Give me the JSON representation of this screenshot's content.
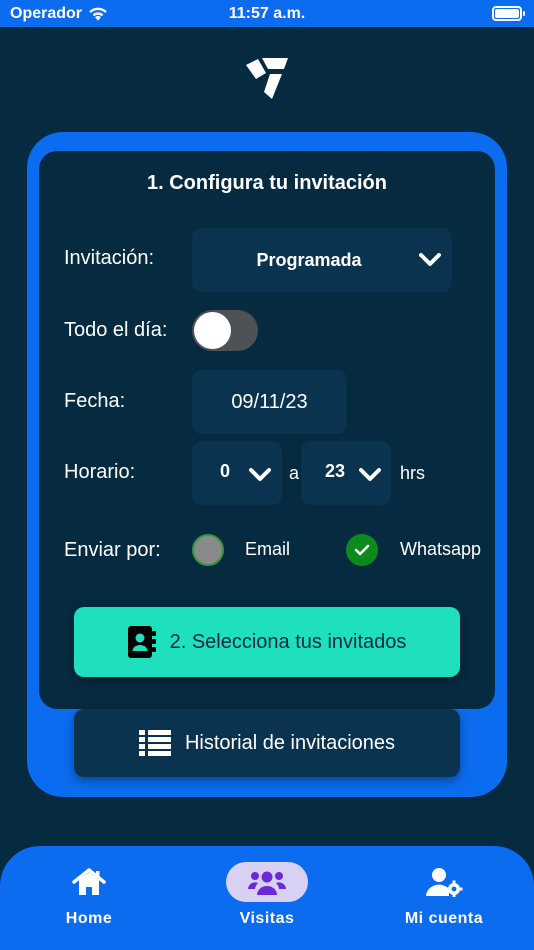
{
  "status_bar": {
    "carrier": "Operador",
    "time": "11:57 a.m."
  },
  "card": {
    "title": "1. Configura tu invitación"
  },
  "form": {
    "invitation_label": "Invitación:",
    "invitation_value": "Programada",
    "allday_label": "Todo el día:",
    "allday_on": false,
    "date_label": "Fecha:",
    "date_value": "09/11/23",
    "time_label": "Horario:",
    "time_from": "0",
    "time_sep": "a",
    "time_to": "23",
    "time_unit": "hrs",
    "send_label": "Enviar por:",
    "option_email": "Email",
    "option_whatsapp": "Whatsapp",
    "email_selected": false,
    "whatsapp_selected": true
  },
  "buttons": {
    "select_guests": "2. Selecciona tus invitados",
    "history": "Historial de invitaciones"
  },
  "nav": {
    "home": "Home",
    "visits": "Visitas",
    "account": "Mi cuenta",
    "active": "visits"
  },
  "colors": {
    "background": "#062b41",
    "accent_blue": "#0c6cf0",
    "teal_button": "#1fe0bc",
    "active_pill": "#d9d1f4",
    "check_green": "#0d8a1c"
  },
  "icons": {
    "wifi": "wifi-icon",
    "battery": "battery-icon",
    "logo": "brand-logo",
    "chevron": "chevron-down-icon",
    "check": "check-icon",
    "contacts": "address-book-icon",
    "list": "list-icon",
    "home": "home-icon",
    "users": "users-icon",
    "user_settings": "user-gear-icon"
  }
}
